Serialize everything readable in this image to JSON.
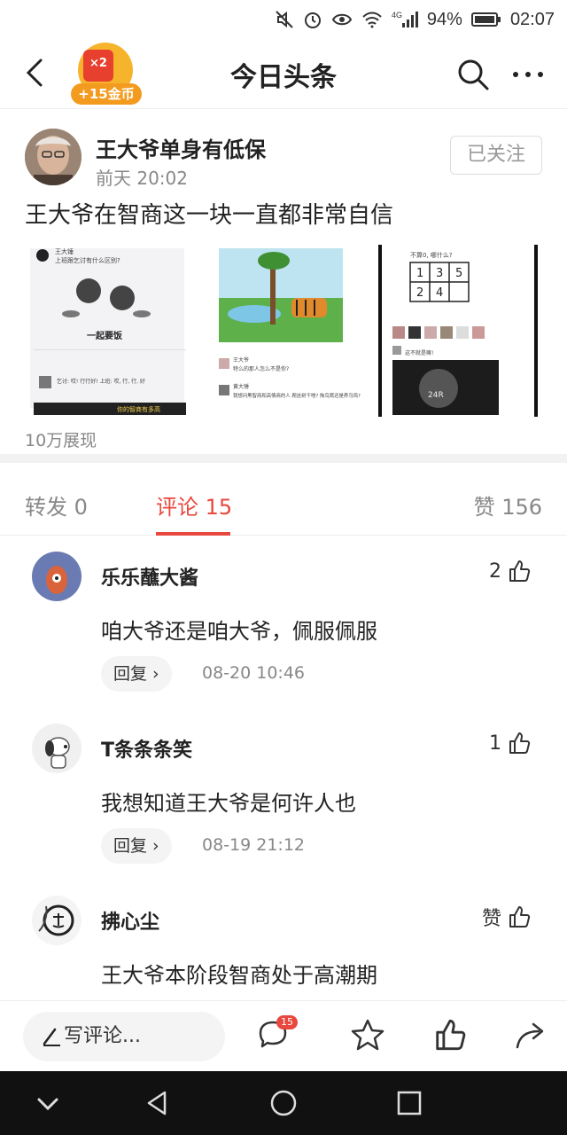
{
  "status_bar": {
    "battery": "94%",
    "time": "02:07",
    "network": "4G"
  },
  "nav": {
    "title": "今日头条",
    "coin_multiplier": "×2",
    "coin_label": "+15金币"
  },
  "post": {
    "author": "王大爷单身有低保",
    "time": "前天  20:02",
    "follow_label": "已关注",
    "text": "王大爷在智商这一块一直都非常自信",
    "views": "10万展现",
    "images": [
      {
        "caption": "你的智商有多高",
        "top_label": "王大锤",
        "question": "上班跟乞讨有什么区别?",
        "mid": "一起要饭",
        "reply": "乞讨: 哎! 行行好! 上班: 哎, 行, 行, 好"
      },
      {
        "sender": "王大爷",
        "msg1": "特么的那人怎么不是你?",
        "sender2": "黄大锤",
        "msg2": "我想问黑智商和高情商的人 爬这树干啥? 掏鸟窝还是养乌鸡?"
      },
      {
        "q": "不算0, 哪什么?",
        "grid": [
          "1",
          "3",
          "5",
          "2",
          "4",
          ""
        ],
        "reply": "这不就是嘛!",
        "knob": "24R"
      }
    ]
  },
  "tabs": {
    "repost": "转发 0",
    "comment": "评论 15",
    "like": "赞 156"
  },
  "comments": [
    {
      "name": "乐乐蘸大酱",
      "text": "咱大爷还是咱大爷，佩服佩服",
      "likes": "2",
      "reply": "回复 ›",
      "date": "08-20 10:46"
    },
    {
      "name": "T条条条笑",
      "text": "我想知道王大爷是何许人也",
      "likes": "1",
      "reply": "回复 ›",
      "date": "08-19 21:12"
    },
    {
      "name": "拂心尘",
      "text": "王大爷本阶段智商处于高潮期",
      "likes": "赞"
    }
  ],
  "action_bar": {
    "write_placeholder": "写评论...",
    "comment_count": "15"
  },
  "colors": {
    "accent": "#e8483d",
    "coin": "#f39b1f"
  }
}
